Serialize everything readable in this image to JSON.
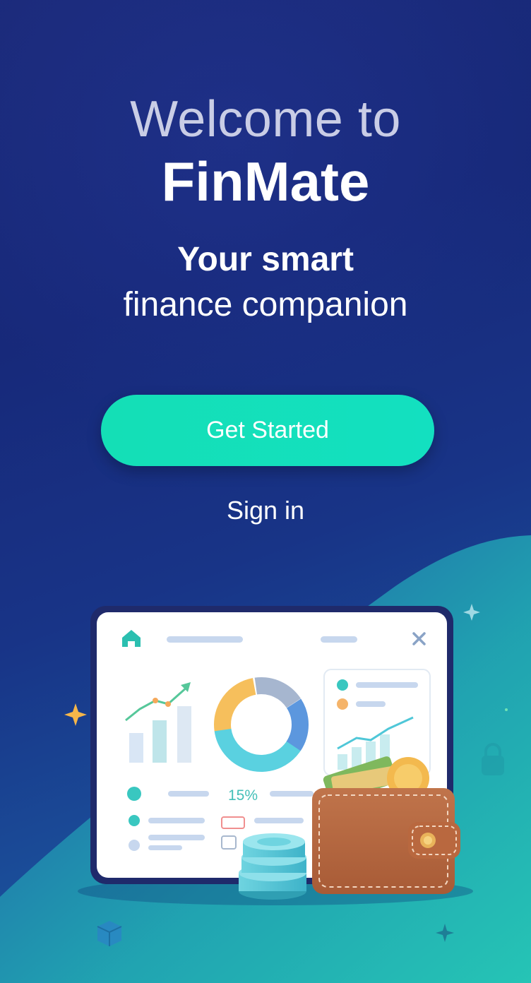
{
  "welcome": {
    "line1": "Welcome to",
    "brand": "FinMate",
    "tagline_line1": "Your smart",
    "tagline_line2": "finance companion"
  },
  "actions": {
    "primary_label": "Get Started",
    "secondary_label": "Sign in"
  },
  "illustration": {
    "percentage_label": "15%"
  },
  "colors": {
    "background_top": "#1b2a7a",
    "background_bottom": "#1d6aa6",
    "accent": "#14dfb6",
    "wave": "#2ab8b4"
  }
}
